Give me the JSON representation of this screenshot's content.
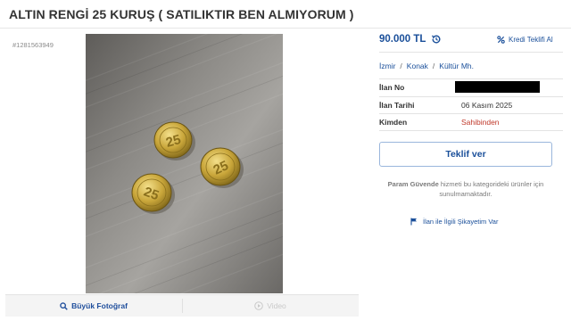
{
  "listing": {
    "title": "ALTIN RENGİ 25 KURUŞ ( SATILIKTIR BEN ALMIYORUM )",
    "id_label": "#1281563949"
  },
  "gallery": {
    "enlarge_label": "Büyük Fotoğraf",
    "video_label": "Video",
    "coin_text": "25"
  },
  "pricing": {
    "price": "90.000 TL",
    "credit_label": "Kredi Teklifi Al"
  },
  "location": {
    "city": "İzmir",
    "district": "Konak",
    "neighborhood": "Kültür Mh."
  },
  "details": [
    {
      "key": "İlan No",
      "value": ""
    },
    {
      "key": "İlan Tarihi",
      "value": "06 Kasım 2025"
    },
    {
      "key": "Kimden",
      "value": "Sahibinden"
    }
  ],
  "actions": {
    "offer_label": "Teklif ver",
    "param_bold": "Param Güvende",
    "param_text": " hizmeti bu kategorideki ürünler için sunulmamaktadır.",
    "complaint_label": "İlan ile İlgili Şikayetim Var"
  },
  "colors": {
    "brand_blue": "#1a4f9a",
    "seller_red": "#c0392b"
  },
  "icons": [
    "history-icon",
    "percent-icon",
    "search-icon",
    "play-icon",
    "flag-icon"
  ]
}
